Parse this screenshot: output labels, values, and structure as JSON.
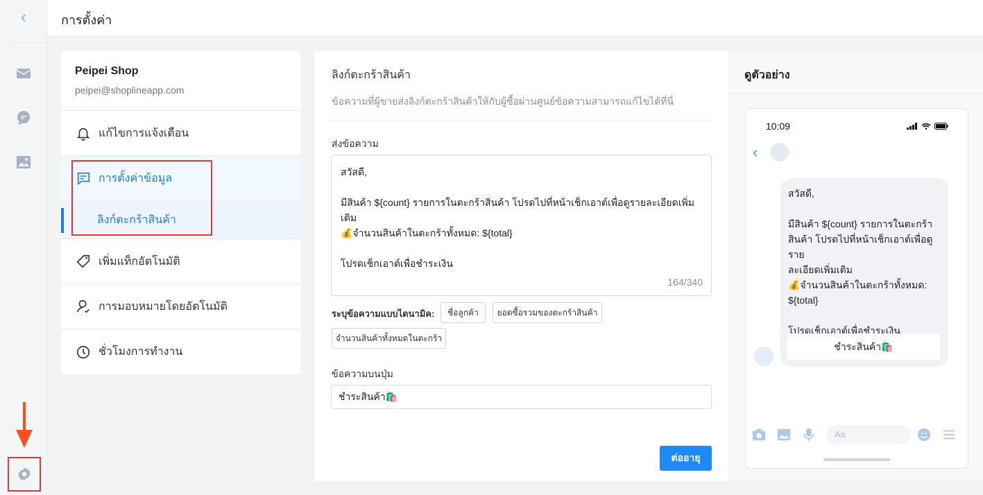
{
  "header": {
    "title": "การตั้งค่า"
  },
  "sidebar_rail": {
    "back_icon": "chevron-left-icon",
    "icons": [
      "mail-icon",
      "chat-icon",
      "image-icon"
    ],
    "settings_icon": "gear-icon"
  },
  "settings_panel": {
    "shop_name": "Peipei Shop",
    "shop_email": "peipei@shoplineapp.com",
    "items": [
      {
        "label": "แก้ไขการแจ้งเตือน",
        "icon": "bell-icon"
      },
      {
        "label": "การตั้งค่าข้อมูล",
        "icon": "message-square-icon"
      },
      {
        "label": "ลิงก์ตะกร้าสินค้า",
        "icon": ""
      },
      {
        "label": "เพิ่มแท็กอัตโนมัติ",
        "icon": "tag-icon"
      },
      {
        "label": "การมอบหมายโดยอัตโนมัติ",
        "icon": "user-icon"
      },
      {
        "label": "ชั่วโมงการทำงาน",
        "icon": "clock-icon"
      }
    ]
  },
  "form": {
    "title": "ลิงก์ตะกร้าสินค้า",
    "description": "ข้อความที่ผู้ขายส่งลิงก์ตะกร้าสินค้าให้กับผู้ซื้อผ่านศูนย์ข้อความสามารถแก้ไขได้ที่นี่",
    "message_label": "ส่งข้อความ",
    "message_lines": {
      "l1": "สวัสดี,",
      "l2": "มีสินค้า ${count} รายการในตะกร้าสินค้า โปรดไปที่หน้าเช็กเอาต์เพื่อดูรายละเอียดเพิ่มเติม",
      "l3": "💰จำนวนสินค้าในตะกร้าทั้งหมด: ${total}",
      "l4": "โปรดเช็กเอาต์เพื่อชำระเงิน"
    },
    "char_count": "164/340",
    "dynamic_label": "ระบุข้อความแบบไดนามิค:",
    "chips": [
      "ชื่อลูกค้า",
      "ยอดซื้อรวมของตะกร้าสินค้า",
      "จำนวนสินค้าทั้งหมดในตะกร้า"
    ],
    "button_text_label": "ข้อความบนปุ่ม",
    "button_text_value": "ชำระสินค้า🛍️",
    "next_button": "ต่ออายุ"
  },
  "preview": {
    "title": "ดูตัวอย่าง",
    "time": "10:09",
    "bubble": {
      "l1": "สวัสดี,",
      "l2a": "มีสินค้า ${count} รายการในตะกร้า",
      "l2b": "สินค้า โปรดไปที่หน้าเช็กเอาต์เพื่อดูราย",
      "l2c": "ละเอียดเพิ่มเติม",
      "l3a": "💰จำนวนสินค้าในตะกร้าทั้งหมด:",
      "l3b": "${total}",
      "l4": "โปรดเช็กเอาต์เพื่อชำระเงิน"
    },
    "pay_button": "ชำระสินค้า🛍️",
    "input_placeholder": "Aa"
  },
  "colors": {
    "accent": "#1d8af5",
    "highlight": "#e53935"
  }
}
